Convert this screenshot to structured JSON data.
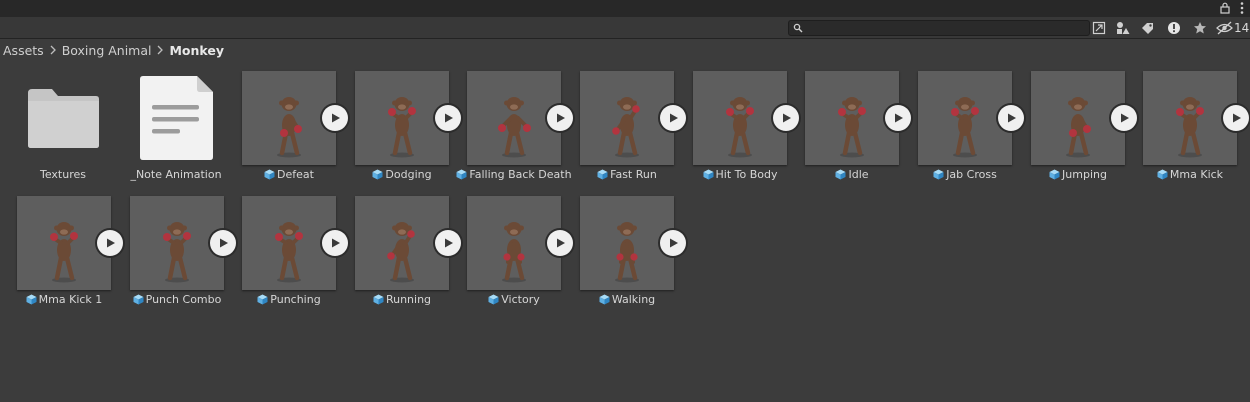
{
  "toolbar": {
    "search_value": "",
    "hidden_count": "14",
    "icons": [
      "lock-icon",
      "kebab-menu-icon",
      "search-icon",
      "create-icon",
      "filter-by-type-icon",
      "label-icon",
      "warning-icon",
      "favorite-star-icon",
      "hidden-packages-icon"
    ]
  },
  "breadcrumb": [
    "Assets",
    "Boxing Animal",
    "Monkey"
  ],
  "folders": [
    {
      "name": "Textures",
      "icon": "folder-icon"
    },
    {
      "name": "_Note Animation",
      "icon": "document-icon"
    }
  ],
  "prefabs": [
    {
      "name": "Defeat",
      "pose": "hunch"
    },
    {
      "name": "Dodging",
      "pose": "guard"
    },
    {
      "name": "Falling Back Death",
      "pose": "wide"
    },
    {
      "name": "Fast Run",
      "pose": "run"
    },
    {
      "name": "Hit To Body",
      "pose": "guard"
    },
    {
      "name": "Idle",
      "pose": "guard"
    },
    {
      "name": "Jab Cross",
      "pose": "guard"
    },
    {
      "name": "Jumping",
      "pose": "hunch"
    },
    {
      "name": "Mma Kick",
      "pose": "guard"
    },
    {
      "name": "Mma Kick 1",
      "pose": "guard"
    },
    {
      "name": "Punch Combo",
      "pose": "guard"
    },
    {
      "name": "Punching",
      "pose": "guard"
    },
    {
      "name": "Running",
      "pose": "run"
    },
    {
      "name": "Victory",
      "pose": "stand"
    },
    {
      "name": "Walking",
      "pose": "stand"
    }
  ],
  "colors": {
    "panel_bg": "#3c3c3c",
    "thumb_bg": "#5e5e5e",
    "monkey_body": "#6b4a36",
    "glove": "#b2343f",
    "prefab_icon": "#5fb0e3"
  }
}
